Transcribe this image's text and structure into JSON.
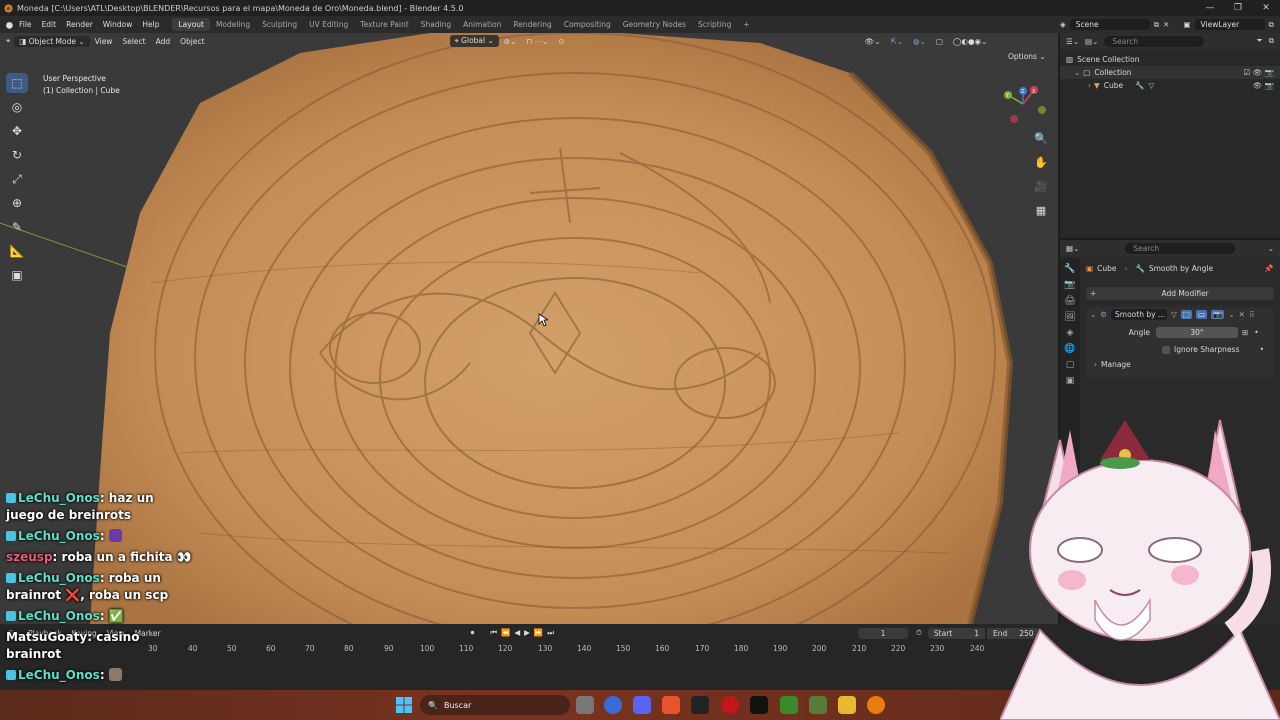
{
  "window": {
    "title": "Moneda [C:\\Users\\ATL\\Desktop\\BLENDER\\Recursos para el mapa\\Moneda de Oro\\Moneda.blend] - Blender 4.5.0",
    "controls": [
      "—",
      "❐",
      "✕"
    ]
  },
  "menu": [
    "File",
    "Edit",
    "Render",
    "Window",
    "Help"
  ],
  "workspaces": [
    {
      "label": "Layout",
      "active": true
    },
    {
      "label": "Modeling",
      "active": false
    },
    {
      "label": "Sculpting",
      "active": false
    },
    {
      "label": "UV Editing",
      "active": false
    },
    {
      "label": "Texture Paint",
      "active": false
    },
    {
      "label": "Shading",
      "active": false
    },
    {
      "label": "Animation",
      "active": false
    },
    {
      "label": "Rendering",
      "active": false
    },
    {
      "label": "Compositing",
      "active": false
    },
    {
      "label": "Geometry Nodes",
      "active": false
    },
    {
      "label": "Scripting",
      "active": false
    }
  ],
  "scene": {
    "scene_label": "Scene",
    "viewlayer_label": "ViewLayer"
  },
  "viewport": {
    "mode": "Object Mode",
    "menus": [
      "View",
      "Select",
      "Add",
      "Object"
    ],
    "transform_orientation": "Global",
    "options_label": "Options",
    "perspective_label": "User Perspective",
    "collection_label": "(1) Collection | Cube",
    "gizmo_axes": {
      "x": "X",
      "y": "Y",
      "z": "Z"
    }
  },
  "outliner": {
    "search_placeholder": "Search",
    "scene_collection": "Scene Collection",
    "collection": "Collection",
    "object": "Cube"
  },
  "properties": {
    "search_placeholder": "Search",
    "breadcrumb_object": "Cube",
    "breadcrumb_modifier": "Smooth by Angle",
    "add_modifier": "Add Modifier",
    "modifier_name": "Smooth by ...",
    "angle_label": "Angle",
    "angle_value": "30°",
    "ignore_sharpness": "Ignore Sharpness",
    "manage": "Manage"
  },
  "timeline": {
    "menus": [
      "Playback",
      "Keying",
      "View",
      "Marker"
    ],
    "current_frame": "1",
    "start_label": "Start",
    "start_value": "1",
    "end_label": "End",
    "end_value": "250",
    "ticks": [
      "30",
      "40",
      "50",
      "60",
      "70",
      "80",
      "90",
      "100",
      "110",
      "120",
      "130",
      "140",
      "150",
      "160",
      "170",
      "180",
      "190",
      "200",
      "210",
      "220",
      "230",
      "240"
    ]
  },
  "taskbar": {
    "search_label": "Buscar"
  },
  "chat": [
    {
      "user": "LeChu_Onos",
      "text": "haz un juego de breinrots",
      "color": "#5be0c8",
      "badge": true
    },
    {
      "user": "LeChu_Onos",
      "text": "",
      "color": "#5be0c8",
      "badge": true,
      "emote": true
    },
    {
      "user": "szeusp",
      "text": "roba un a fichita 👀",
      "color": "#e85a7a",
      "badge": false
    },
    {
      "user": "LeChu_Onos",
      "text": "roba un brainrot ❌, roba un scp",
      "color": "#5be0c8",
      "badge": true
    },
    {
      "user": "LeChu_Onos",
      "text": "✅",
      "color": "#5be0c8",
      "badge": true
    },
    {
      "user": "MatsuGoaty",
      "text": "casino brainrot",
      "color": "#ffffff",
      "badge": false
    },
    {
      "user": "LeChu_Onos",
      "text": "",
      "color": "#5be0c8",
      "badge": true,
      "emote": true
    }
  ],
  "colors": {
    "accent": "#3f5a84",
    "coin": "#c8975f",
    "panel": "#2a2a2a"
  }
}
